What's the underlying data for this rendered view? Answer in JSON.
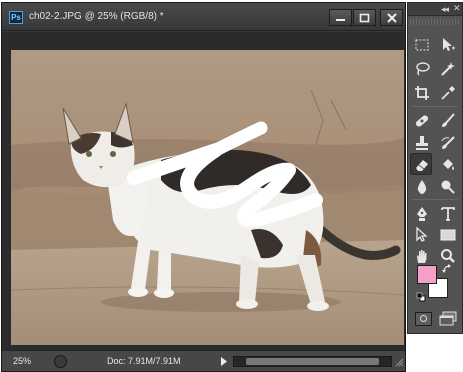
{
  "document": {
    "app_badge": "Ps",
    "title": "ch02-2.JPG @ 25% (RGB/8) *",
    "window_buttons": [
      "minimize-icon",
      "maximize-icon",
      "close-icon"
    ]
  },
  "statusbar": {
    "zoom": "25%",
    "doc_info": "Doc: 7.91M/7.91M"
  },
  "colors": {
    "foreground": "#f4a0c8",
    "background": "#ffffff",
    "brush_stroke": "#ffffff"
  },
  "tools": [
    "rectangular-marquee-tool",
    "move-tool",
    "lasso-tool",
    "quick-selection-tool",
    "crop-tool",
    "eyedropper-tool",
    "spot-healing-brush-tool",
    "brush-tool",
    "clone-stamp-tool",
    "history-brush-tool",
    "eraser-tool",
    "paint-bucket-tool",
    "blur-tool",
    "dodge-tool",
    "pen-tool",
    "type-tool",
    "path-selection-tool",
    "rectangle-tool",
    "hand-tool",
    "zoom-tool"
  ],
  "active_tool": "eraser-tool"
}
